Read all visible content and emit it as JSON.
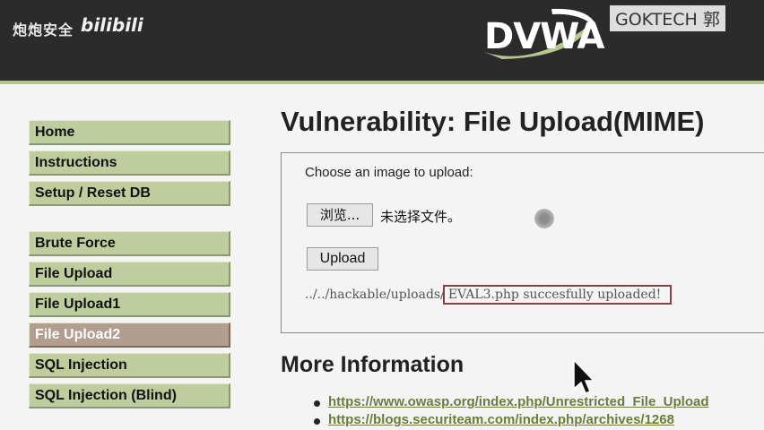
{
  "header": {
    "watermark_cn": "炮炮安全",
    "watermark_bili": "bilibili",
    "logo_text": "DVWA",
    "watermark_right": "GOKTECH  郭"
  },
  "nav": {
    "group1": [
      {
        "label": "Home"
      },
      {
        "label": "Instructions"
      },
      {
        "label": "Setup / Reset DB"
      }
    ],
    "group2": [
      {
        "label": "Brute Force"
      },
      {
        "label": "File Upload"
      },
      {
        "label": "File Upload1"
      },
      {
        "label": "File Upload2",
        "selected": true
      },
      {
        "label": "SQL Injection"
      },
      {
        "label": "SQL Injection (Blind)"
      }
    ]
  },
  "main": {
    "title": "Vulnerability: File Upload(MIME)",
    "choose_label": "Choose an image to upload:",
    "browse_label": "浏览...",
    "no_file_label": "未选择文件。",
    "upload_label": "Upload",
    "result_prefix": "../../hackable/uploads/",
    "result_highlight": "EVAL3.php succesfully uploaded!",
    "more_info_title": "More Information",
    "links": [
      "https://www.owasp.org/index.php/Unrestricted_File_Upload",
      "https://blogs.securiteam.com/index.php/archives/1268"
    ]
  },
  "colors": {
    "header_bg": "#2b2b2b",
    "nav_bg": "#bfcc9d",
    "nav_selected_bg": "#b29d8f",
    "link": "#6b7d36",
    "highlight_border": "#8a4040"
  }
}
